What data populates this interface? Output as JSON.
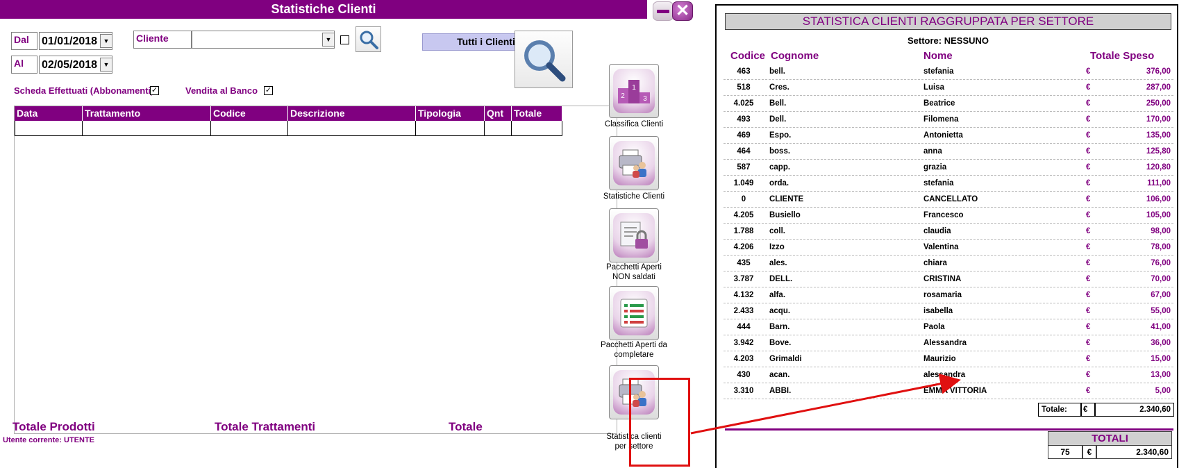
{
  "window": {
    "title": "Statistiche Clienti"
  },
  "filters": {
    "dal_label": "Dal",
    "dal_value": "01/01/2018",
    "al_label": "Al",
    "al_value": "02/05/2018",
    "cliente_label": "Cliente",
    "cliente_value": "",
    "tutti_clienti_label": "Tutti i Clienti",
    "scheda_label": "Scheda Effettuati (Abbonamenti)",
    "scheda_checked": true,
    "vendita_label": "Vendita al Banco",
    "vendita_checked": true
  },
  "grid": {
    "columns": [
      "Data",
      "Trattamento",
      "Codice",
      "Descrizione",
      "Tipologia",
      "Qnt",
      "Totale"
    ]
  },
  "footer": {
    "totale_prodotti": "Totale Prodotti",
    "totale_trattamenti": "Totale Trattamenti",
    "totale": "Totale",
    "utente": "Utente corrente: UTENTE"
  },
  "side_buttons": [
    {
      "label": "Classifica Clienti",
      "icon": "podium-icon"
    },
    {
      "label": "Statistiche Clienti",
      "icon": "printer-people-icon"
    },
    {
      "label": "Pacchetti Aperti NON saldati",
      "icon": "document-lock-icon"
    },
    {
      "label": "Pacchetti Aperti da completare",
      "icon": "checklist-icon"
    },
    {
      "label": "Statistica clienti per settore",
      "icon": "printer-people-icon"
    }
  ],
  "report": {
    "title": "STATISTICA  CLIENTI RAGGRUPPATA PER SETTORE",
    "settore": "Settore: NESSUNO",
    "headers": {
      "codice": "Codice",
      "cognome": "Cognome",
      "nome": "Nome",
      "totale": "Totale Speso"
    },
    "currency": "€",
    "rows": [
      {
        "codice": "463",
        "cognome": "bell.",
        "nome": "stefania",
        "totale": "376,00"
      },
      {
        "codice": "518",
        "cognome": "Cres.",
        "nome": "Luisa",
        "totale": "287,00"
      },
      {
        "codice": "4.025",
        "cognome": "Bell.",
        "nome": "Beatrice",
        "totale": "250,00"
      },
      {
        "codice": "493",
        "cognome": "Dell.",
        "nome": "Filomena",
        "totale": "170,00"
      },
      {
        "codice": "469",
        "cognome": "Espo.",
        "nome": "Antonietta",
        "totale": "135,00"
      },
      {
        "codice": "464",
        "cognome": "boss.",
        "nome": "anna",
        "totale": "125,80"
      },
      {
        "codice": "587",
        "cognome": "capp.",
        "nome": "grazia",
        "totale": "120,80"
      },
      {
        "codice": "1.049",
        "cognome": "orda.",
        "nome": "stefania",
        "totale": "111,00"
      },
      {
        "codice": "0",
        "cognome": "CLIENTE",
        "nome": "CANCELLATO",
        "totale": "106,00"
      },
      {
        "codice": "4.205",
        "cognome": "Busiello",
        "nome": "Francesco",
        "totale": "105,00"
      },
      {
        "codice": "1.788",
        "cognome": "coll.",
        "nome": "claudia",
        "totale": "98,00"
      },
      {
        "codice": "4.206",
        "cognome": "Izzo",
        "nome": "Valentina",
        "totale": "78,00"
      },
      {
        "codice": "435",
        "cognome": "ales.",
        "nome": "chiara",
        "totale": "76,00"
      },
      {
        "codice": "3.787",
        "cognome": "DELL.",
        "nome": "CRISTINA",
        "totale": "70,00"
      },
      {
        "codice": "4.132",
        "cognome": "alfa.",
        "nome": "rosamaria",
        "totale": "67,00"
      },
      {
        "codice": "2.433",
        "cognome": "acqu.",
        "nome": "isabella",
        "totale": "55,00"
      },
      {
        "codice": "444",
        "cognome": "Barn.",
        "nome": "Paola",
        "totale": "41,00"
      },
      {
        "codice": "3.942",
        "cognome": "Bove.",
        "nome": "Alessandra",
        "totale": "36,00"
      },
      {
        "codice": "4.203",
        "cognome": "Grimaldi",
        "nome": "Maurizio",
        "totale": "15,00"
      },
      {
        "codice": "430",
        "cognome": "acan.",
        "nome": "alessandra",
        "totale": "13,00"
      },
      {
        "codice": "3.310",
        "cognome": "ABBI.",
        "nome": "EMMA VITTORIA",
        "totale": "5,00"
      }
    ],
    "totale_label": "Totale:",
    "totale_value": "2.340,60",
    "totali_label": "TOTALI",
    "totali_count": "75",
    "totali_value": "2.340,60"
  },
  "colors": {
    "accent": "#800080",
    "highlight": "#e01010",
    "button": "#c8c8f0"
  }
}
